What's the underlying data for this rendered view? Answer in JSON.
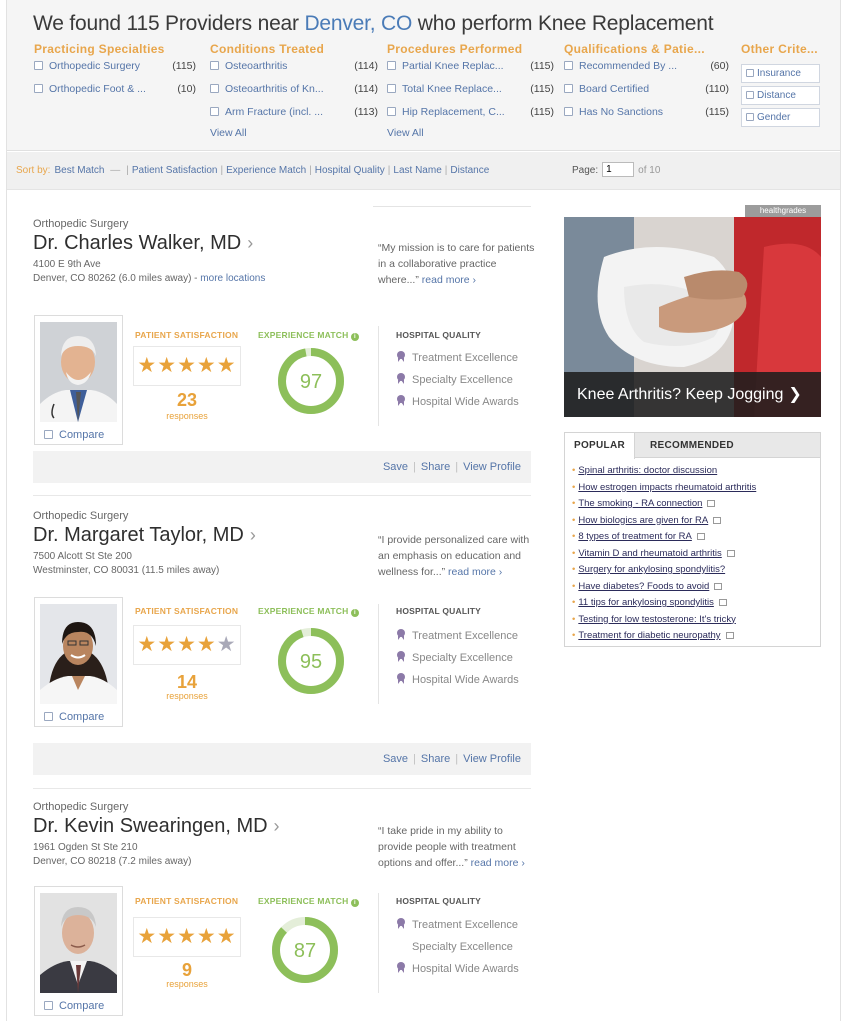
{
  "header": {
    "headline_prefix": "We found 115 Providers near ",
    "headline_location": "Denver, CO",
    "headline_suffix": " who perform Knee Replacement"
  },
  "filters": {
    "practicing_specialties": {
      "title": "Practicing Specialties",
      "items": [
        {
          "label": "Orthopedic Surgery",
          "count": "(115)"
        },
        {
          "label": "Orthopedic Foot & ...",
          "count": "(10)"
        }
      ]
    },
    "conditions_treated": {
      "title": "Conditions Treated",
      "items": [
        {
          "label": "Osteoarthritis",
          "count": "(114)"
        },
        {
          "label": "Osteoarthritis of Kn...",
          "count": "(114)"
        },
        {
          "label": "Arm Fracture (incl. ...",
          "count": "(113)"
        }
      ],
      "view_all": "View All"
    },
    "procedures_performed": {
      "title": "Procedures Performed",
      "items": [
        {
          "label": "Partial Knee Replac...",
          "count": "(115)"
        },
        {
          "label": "Total Knee Replace...",
          "count": "(115)"
        },
        {
          "label": "Hip Replacement, C...",
          "count": "(115)"
        }
      ],
      "view_all": "View All"
    },
    "qualifications": {
      "title": "Qualifications & Patie...",
      "items": [
        {
          "label": "Recommended By ...",
          "count": "(60)"
        },
        {
          "label": "Board Certified",
          "count": "(110)"
        },
        {
          "label": "Has No Sanctions",
          "count": "(115)"
        }
      ]
    },
    "other": {
      "title": "Other Crite...",
      "items": [
        "Insurance",
        "Distance",
        "Gender"
      ]
    }
  },
  "sortbar": {
    "label": "Sort by:",
    "active": "Best Match",
    "active_arrow": "—",
    "options": [
      "Patient Satisfaction",
      "Experience Match",
      "Hospital Quality",
      "Last Name",
      "Distance"
    ],
    "page_label": "Page:",
    "page_value": "1",
    "page_of": "of 10"
  },
  "labels": {
    "patient_satisfaction": "PATIENT SATISFACTION",
    "experience_match": "EXPERIENCE MATCH",
    "hospital_quality": "HOSPITAL QUALITY",
    "compare": "Compare",
    "responses": "responses",
    "save": "Save",
    "share": "Share",
    "view_profile": "View Profile",
    "read_more": "read more"
  },
  "providers": [
    {
      "specialty": "Orthopedic Surgery",
      "name": "Dr. Charles Walker, MD",
      "address1": "4100 E 9th Ave",
      "address2": "Denver, CO 80262 (6.0 miles away) - ",
      "more_locations": "more locations",
      "quote": "“My mission is to care for patients in a collaborative practice where...”",
      "stars": "★★★★★",
      "stars_rating": 5,
      "responses": "23",
      "experience": "97",
      "hospital_quality": [
        "Treatment Excellence",
        "Specialty Excellence",
        "Hospital Wide Awards"
      ]
    },
    {
      "specialty": "Orthopedic Surgery",
      "name": "Dr. Margaret Taylor, MD",
      "address1": "7500 Alcott St Ste 200",
      "address2": "Westminster, CO 80031 (11.5 miles away)",
      "quote": "“I provide personalized care with an emphasis on education and wellness for...”",
      "stars": "★★★★",
      "stars_half": "★",
      "stars_rating": 4.5,
      "responses": "14",
      "experience": "95",
      "hospital_quality": [
        "Treatment Excellence",
        "Specialty Excellence",
        "Hospital Wide Awards"
      ]
    },
    {
      "specialty": "Orthopedic Surgery",
      "name": "Dr. Kevin Swearingen, MD",
      "address1": "1961 Ogden St Ste 210",
      "address2": "Denver, CO 80218 (7.2 miles away)",
      "quote": "“I take pride in my ability to provide people with treatment options and offer...”",
      "stars": "★★★★★",
      "stars_rating": 5,
      "responses": "9",
      "experience": "87",
      "hospital_quality": [
        "Treatment Excellence",
        "Specialty Excellence",
        "Hospital Wide Awards"
      ]
    }
  ],
  "ad": {
    "tag": "healthgrades",
    "caption": "Knee Arthritis? Keep Jogging",
    "chevron": "❯"
  },
  "tabs": {
    "popular": "POPULAR",
    "recommended": "RECOMMENDED",
    "items": [
      {
        "text": "Spinal arthritis: doctor discussion",
        "icon": false
      },
      {
        "text": "How estrogen impacts rheumatoid arthritis",
        "icon": false
      },
      {
        "text": "The smoking - RA connection",
        "icon": true
      },
      {
        "text": "How biologics are given for RA",
        "icon": true
      },
      {
        "text": "8 types of treatment for RA",
        "icon": true
      },
      {
        "text": "Vitamin D and rheumatoid arthritis",
        "icon": true
      },
      {
        "text": "Surgery for ankylosing spondylitis?",
        "icon": false
      },
      {
        "text": "Have diabetes? Foods to avoid",
        "icon": true
      },
      {
        "text": "11 tips for ankylosing spondylitis",
        "icon": true
      },
      {
        "text": "Testing for low testosterone: It's tricky",
        "icon": false
      },
      {
        "text": "Treatment for diabetic neuropathy",
        "icon": true
      }
    ]
  },
  "colors": {
    "accent_orange": "#e8a64c",
    "link_blue": "#5575a8",
    "experience_green": "#8dbf5a"
  }
}
